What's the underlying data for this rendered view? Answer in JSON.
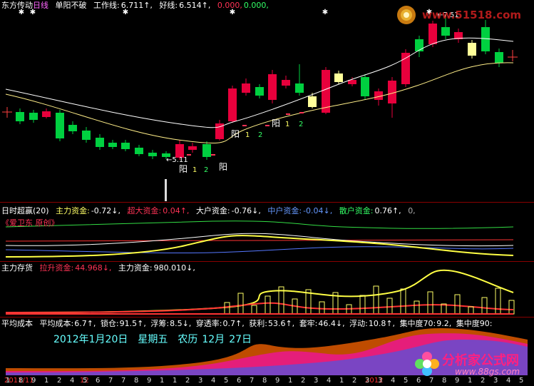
{
  "main": {
    "stock": "东方传动",
    "period": "日线",
    "formula": "单阳不破",
    "work_line_label": "工作线:",
    "work_line_value": "6.711↑,",
    "good_line_label": "好线:",
    "good_line_value": "6.514↑,",
    "zero1": "0.000,",
    "zero2": "0.000,",
    "low_mark": "←5.11",
    "high_mark": "←7.51",
    "yang": "阳",
    "one": "1",
    "two": "2"
  },
  "panel2": {
    "title": "日时超赢(20)",
    "main_fund_label": "主力资金:",
    "main_fund_value": "-0.72↓,",
    "super_label": "超大资金:",
    "super_value": "0.04↑,",
    "large_label": "大户资金:",
    "large_value": "-0.76↓,",
    "mid_label": "中户资金:",
    "mid_value": "-0.04↓,",
    "retail_label": "散户资金:",
    "retail_value": "0.76↑,",
    "zero": "0,",
    "subtitle": "《爱卫东 原创》"
  },
  "panel3": {
    "title": "主力存货",
    "lift_label": "拉升资金:",
    "lift_value": "44.968↓,",
    "main_label": "主力资金:",
    "main_value": "980.010↓,"
  },
  "panel4": {
    "title": "平均成本",
    "avg_label": "平均成本:",
    "avg_value": "6.7↑,",
    "lock_label": "锁仓:",
    "lock_value": "91.5↑,",
    "float_label": "浮筹:",
    "float_value": "8.5↓,",
    "pen_label": "穿透率:",
    "pen_value": "0.7↑,",
    "profit_label": "获利:",
    "profit_value": "53.6↑,",
    "trap_label": "套牢:",
    "trap_value": "46.4↓,",
    "vol_label": "浮动:",
    "vol_value": "10.8↑,",
    "c70_label": "集中度70:",
    "c70_value": "9.2,",
    "c90_label": "集中度90:"
  },
  "calendar": {
    "date": "2012年1月20日",
    "weekday": "星期五",
    "lunar": "农历",
    "lunar_month": "12月",
    "lunar_day": "27日"
  },
  "axis": {
    "digits": [
      "1",
      "8",
      "9",
      "1",
      "2",
      "4",
      "5",
      "6",
      "7",
      "7",
      "8",
      "9",
      "1",
      "1",
      "2",
      "3",
      "4",
      "5",
      "6",
      "7",
      "8",
      "9",
      "1",
      "2",
      "3",
      "4",
      "1",
      "2",
      "3",
      "3",
      "4",
      "5",
      "6",
      "7",
      "8",
      "9",
      "1",
      "2",
      "3",
      "4",
      "5"
    ],
    "label_left": "2011/11",
    "label_mid": "12",
    "label_right": "2012"
  },
  "logo": {
    "top_url": "www.51518.com",
    "brand": "分析家公式网",
    "bottom_url": "www.88gs.com"
  },
  "colors": {
    "up": "#e8003c",
    "down": "#00d040",
    "white_line": "#ffffff",
    "yellow_line": "#ffff66",
    "magenta": "#ff00ff",
    "cyan": "#66ffff",
    "sep": "#8a0000"
  }
}
